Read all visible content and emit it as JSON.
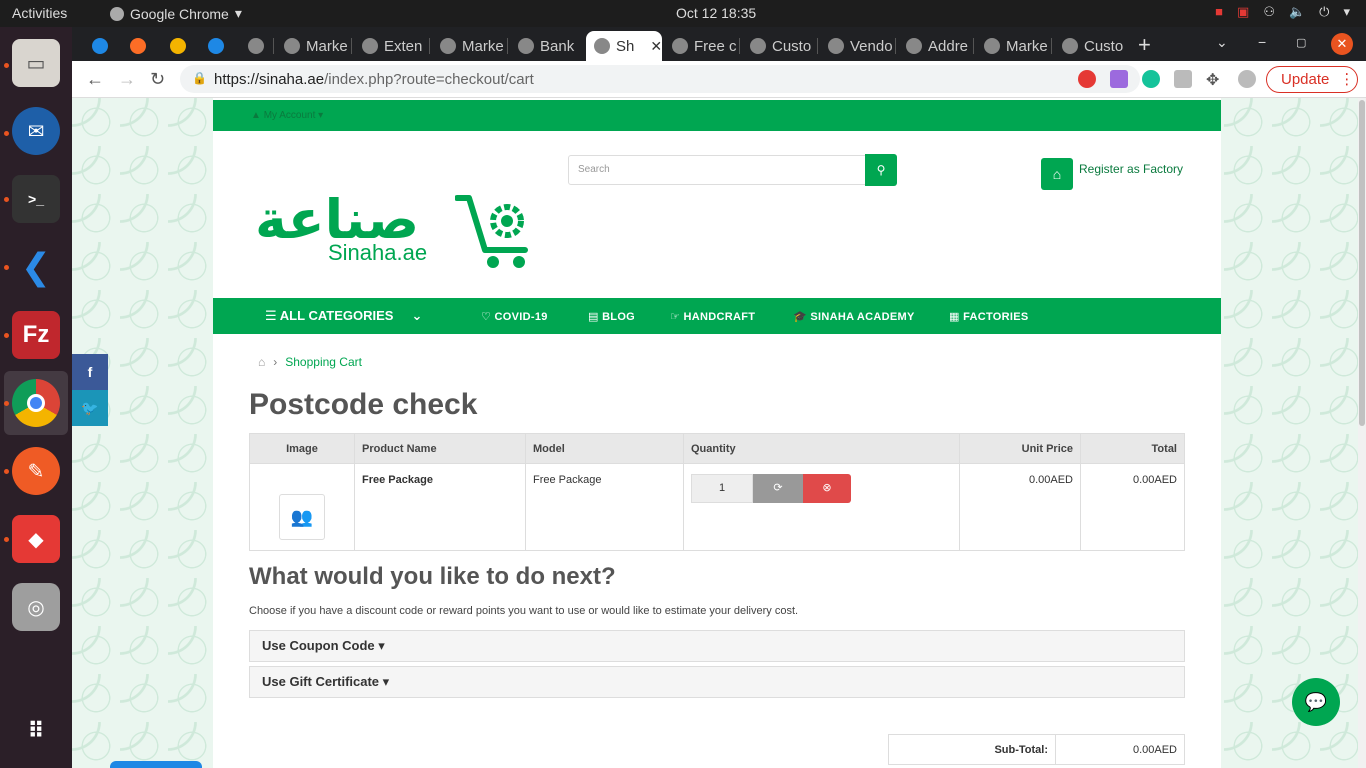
{
  "system": {
    "activities": "Activities",
    "app_name": "Google Chrome",
    "clock": "Oct 12  18:35"
  },
  "browser": {
    "tabs": [
      {
        "label": ""
      },
      {
        "label": ""
      },
      {
        "label": ""
      },
      {
        "label": ""
      },
      {
        "label": ""
      },
      {
        "label": "Marke"
      },
      {
        "label": "Exten"
      },
      {
        "label": "Marke"
      },
      {
        "label": "Bank"
      },
      {
        "label": "Sh",
        "active": true
      },
      {
        "label": "Free c"
      },
      {
        "label": "Custo"
      },
      {
        "label": "Vendo"
      },
      {
        "label": "Addre"
      },
      {
        "label": "Marke"
      },
      {
        "label": "Custo"
      }
    ],
    "url_host": "https://sinaha.ae",
    "url_path": "/index.php?route=checkout/cart",
    "update_label": "Update"
  },
  "site": {
    "account_label": "My Account",
    "logo_arabic": "صناعة",
    "logo_english": "Sinaha.ae",
    "search_placeholder": "Search",
    "register_label": "Register as Factory",
    "menu": {
      "all_categories": "ALL CATEGORIES",
      "items": [
        "COVID-19",
        "BLOG",
        "HANDCRAFT",
        "SINAHA ACADEMY",
        "FACTORIES"
      ]
    },
    "breadcrumb": "Shopping Cart",
    "page_title": "Postcode check",
    "cart_table": {
      "headers": [
        "Image",
        "Product Name",
        "Model",
        "Quantity",
        "Unit Price",
        "Total"
      ],
      "rows": [
        {
          "name": "Free Package",
          "model": "Free Package",
          "quantity": "1",
          "unit_price": "0.00AED",
          "total": "0.00AED"
        }
      ]
    },
    "next_title": "What would you like to do next?",
    "next_hint": "Choose if you have a discount code or reward points you want to use or would like to estimate your delivery cost.",
    "panels": [
      "Use Coupon Code",
      "Use Gift Certificate"
    ],
    "totals": [
      {
        "label": "Sub-Total:",
        "value": "0.00AED"
      }
    ]
  },
  "colors": {
    "brand_green": "#00a651",
    "remove_red": "#e04a4a",
    "chrome_dark": "#202124"
  }
}
